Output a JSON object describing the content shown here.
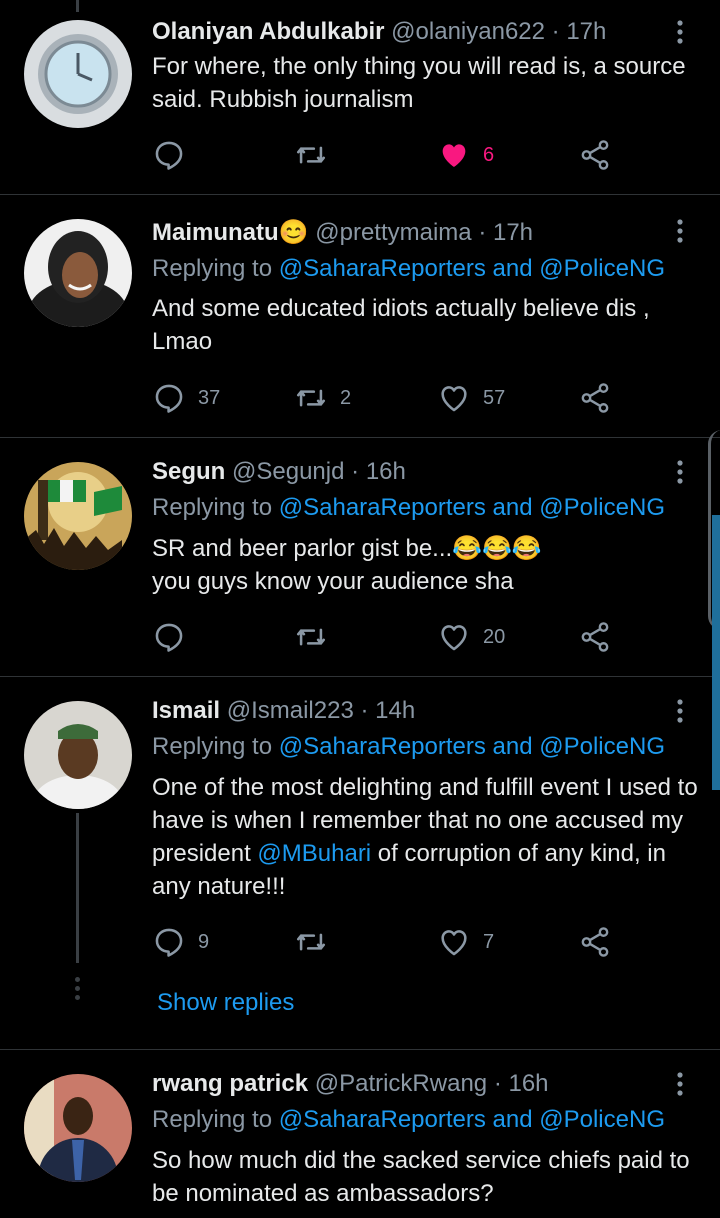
{
  "tweets": [
    {
      "name": "Olaniyan Abdulkabir",
      "handle": "@olaniyan622",
      "dot": "·",
      "time": "17h",
      "replying_prefix": "",
      "replying_links": "",
      "text": "For where, the only thing you will read is, a source said. Rubbish journalism",
      "replies": "",
      "retweets": "",
      "likes": "6",
      "liked": true
    },
    {
      "name": "Maimunatu😊",
      "handle": "@prettymaima",
      "dot": "·",
      "time": "17h",
      "replying_prefix": "Replying to",
      "replying_links": "@SaharaReporters and @PoliceNG",
      "text": "And some educated idiots actually believe dis , Lmao",
      "replies": "37",
      "retweets": "2",
      "likes": "57",
      "liked": false
    },
    {
      "name": "Segun",
      "handle": "@Segunjd",
      "dot": "·",
      "time": "16h",
      "replying_prefix": "Replying to",
      "replying_links": "@SaharaReporters and @PoliceNG",
      "text_line1": "SR and beer parlor gist be...😂😂😂",
      "text_line2": "you guys know your audience sha",
      "replies": "",
      "retweets": "",
      "likes": "20",
      "liked": false
    },
    {
      "name": "Ismail",
      "handle": "@Ismail223",
      "dot": "·",
      "time": "14h",
      "replying_prefix": "Replying to",
      "replying_links": "@SaharaReporters and @PoliceNG",
      "text_before": "One of the most delighting and fulfill event I used to have is when I remember that no one accused my president ",
      "text_mention": "@MBuhari",
      "text_after": " of corruption of any kind, in any nature!!!",
      "replies": "9",
      "retweets": "",
      "likes": "7",
      "liked": false,
      "show_replies": "Show replies"
    },
    {
      "name": "rwang patrick",
      "handle": "@PatrickRwang",
      "dot": "·",
      "time": "16h",
      "replying_prefix": "Replying to",
      "replying_links": "@SaharaReporters and @PoliceNG",
      "text": "So how much did the sacked service chiefs paid to be nominated as ambassadors?"
    }
  ],
  "colors": {
    "background": "#000000",
    "link": "#1d9bf0",
    "like_active": "#f91880",
    "muted": "#8b98a5",
    "text": "#e7e9ea"
  },
  "icons": {
    "reply": "reply-icon",
    "retweet": "retweet-icon",
    "like": "heart-icon",
    "share": "share-icon",
    "more": "more-vertical-icon"
  }
}
